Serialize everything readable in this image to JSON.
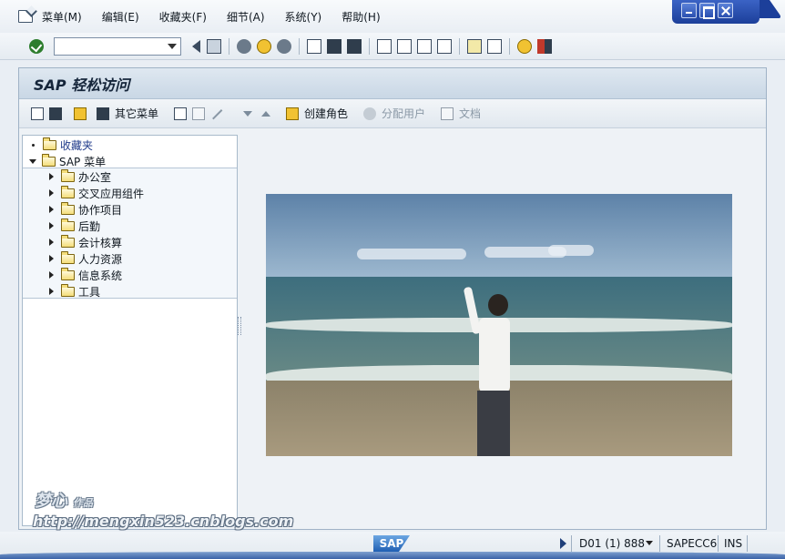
{
  "menubar": {
    "items": [
      "菜单(M)",
      "编辑(E)",
      "收藏夹(F)",
      "细节(A)",
      "系统(Y)",
      "帮助(H)"
    ]
  },
  "command_field": {
    "value": ""
  },
  "window": {
    "title": "SAP 轻松访问"
  },
  "app_toolbar": {
    "other_menu": "其它菜单",
    "create_role": "创建角色",
    "assign_users": "分配用户",
    "documentation": "文档"
  },
  "tree": {
    "favorites": "收藏夹",
    "sap_menu": "SAP 菜单",
    "children": [
      "办公室",
      "交叉应用组件",
      "协作项目",
      "后勤",
      "会计核算",
      "人力资源",
      "信息系统",
      "工具"
    ]
  },
  "watermark": {
    "author": "梦心",
    "author_suffix": "作品",
    "url": "http://mengxin523.cnblogs.com"
  },
  "status": {
    "logo": "SAP",
    "system": "D01 (1) 888",
    "server": "SAPECC6",
    "mode": "INS"
  }
}
